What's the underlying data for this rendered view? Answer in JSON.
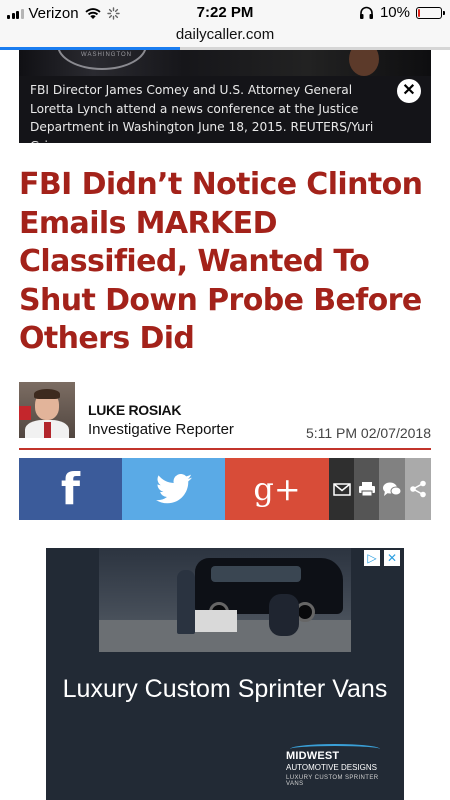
{
  "status": {
    "carrier": "Verizon",
    "time": "7:22 PM",
    "battery_percent": "10%",
    "battery_level": 0.1,
    "battery_color": "#e0231a"
  },
  "browser": {
    "url": "dailycaller.com",
    "load_progress": 0.4
  },
  "hero": {
    "caption": "FBI Director James Comey and U.S. Attorney General Loretta Lynch attend a news conference at the Justice Department in Washington June 18, 2015. REUTERS/Yuri Gripas",
    "close_icon": "close-icon"
  },
  "article": {
    "headline": "FBI Didn’t Notice Clinton Emails MARKED Classified, Wanted To Shut Down Probe Before Others Did",
    "headline_color": "#a3221a"
  },
  "byline": {
    "author": "LUKE ROSIAK",
    "role": "Investigative Reporter",
    "timestamp": "5:11 PM 02/07/2018"
  },
  "share": {
    "facebook": "f",
    "google_plus": "g+",
    "icons": [
      "facebook-icon",
      "twitter-icon",
      "google-plus-icon",
      "mail-icon",
      "print-icon",
      "comments-icon",
      "share-icon"
    ],
    "colors": {
      "facebook": "#3b5b9a",
      "twitter": "#5aaae6",
      "google_plus": "#d84c38"
    }
  },
  "ad": {
    "headline": "Luxury Custom Sprinter Vans",
    "logo_main": "MIDWEST",
    "logo_sub": "AUTOMOTIVE DESIGNS",
    "logo_tag": "LUXURY CUSTOM SPRINTER VANS",
    "choices_icons": [
      "adchoices-icon",
      "close-icon"
    ]
  }
}
